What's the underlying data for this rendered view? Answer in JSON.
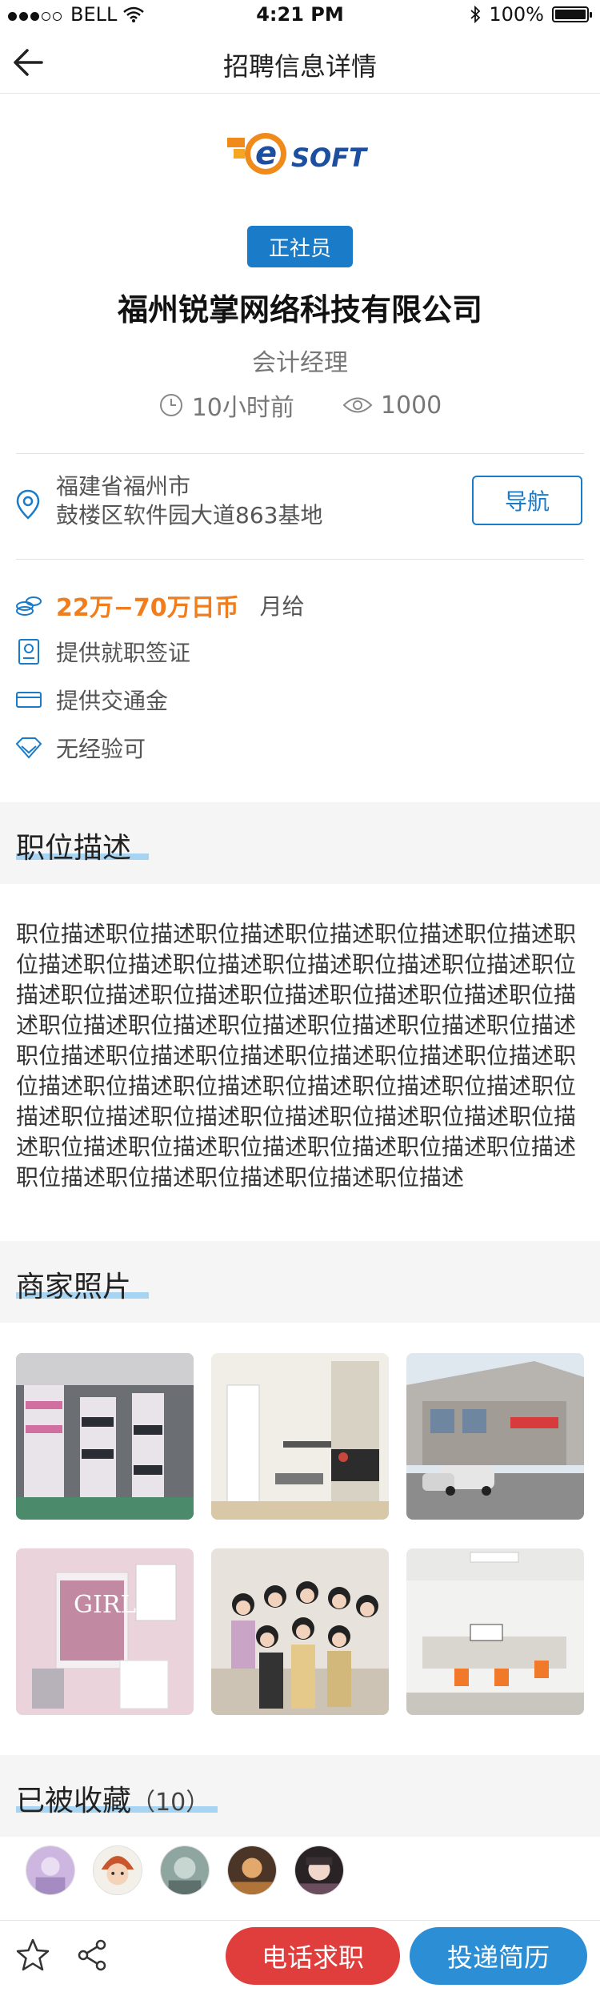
{
  "status_bar": {
    "carrier": "BELL",
    "time": "4:21 PM",
    "battery": "100%"
  },
  "nav": {
    "title": "招聘信息详情"
  },
  "job": {
    "logo_text": "SOFT",
    "type_tag": "正社员",
    "company": "福州锐掌网络科技有限公司",
    "position": "会计经理",
    "posted": "10小时前",
    "views": "1000"
  },
  "address": {
    "line1": "福建省福州市",
    "line2": "鼓楼区软件园大道863基地",
    "nav_button": "导航"
  },
  "benefits": {
    "salary": "22万−70万日币",
    "salary_period": "月给",
    "visa": "提供就职签证",
    "transport": "提供交通金",
    "experience": "无经验可"
  },
  "sections": {
    "description_title": "职位描述",
    "description_text": "职位描述职位描述职位描述职位描述职位描述职位描述职位描述职位描述职位描述职位描述职位描述职位描述职位描述职位描述职位描述职位描述职位描述职位描述职位描述职位描述职位描述职位描述职位描述职位描述职位描述职位描述职位描述职位描述职位描述职位描述职位描述职位描述职位描述职位描述职位描述职位描述职位描述职位描述职位描述职位描述职位描述职位描述职位描述职位描述职位描述职位描述职位描述职位描述职位描述职位描述职位描述职位描述职位描述职位描述职位描述",
    "photos_title": "商家照片",
    "favorites_title": "已被收藏",
    "favorites_count": "（10）"
  },
  "bottom": {
    "call_button": "电话求职",
    "apply_button": "投递简历"
  },
  "colors": {
    "brand_blue": "#1a7bc9",
    "salary_orange": "#f07e1f",
    "call_red": "#e03d3d",
    "apply_blue": "#2c8fd6"
  }
}
